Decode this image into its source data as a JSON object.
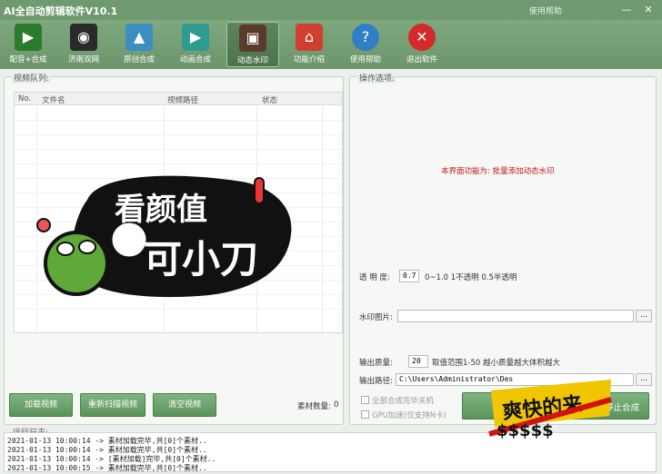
{
  "window": {
    "title": "AI全自动剪辑软件V10.1",
    "help_link": "使用帮助",
    "min_glyph": "—",
    "close_glyph": "✕"
  },
  "toolbar": {
    "items": [
      {
        "label": "配音+合成",
        "icon": "clapperboard-icon",
        "color": "#2c7a2c"
      },
      {
        "label": "济南双网",
        "icon": "film-reel-icon",
        "color": "#2a2a2a"
      },
      {
        "label": "原创合成",
        "icon": "image-icon",
        "color": "#3a8fc0"
      },
      {
        "label": "动画合成",
        "icon": "film-strip-icon",
        "color": "#2f9a8f"
      },
      {
        "label": "动态水印",
        "icon": "picture-frame-icon",
        "color": "#5a3a2a"
      },
      {
        "label": "功能介绍",
        "icon": "home-icon",
        "color": "#d04030"
      },
      {
        "label": "使用帮助",
        "icon": "help-icon",
        "color": "#2f7fc8"
      },
      {
        "label": "退出软件",
        "icon": "exit-icon",
        "color": "#d42a2a"
      }
    ]
  },
  "video_queue": {
    "title": "视频队列:",
    "columns": [
      "No.",
      "文件名",
      "视频路径",
      "状态"
    ],
    "buttons": {
      "load": "加载视频",
      "rescan": "重新扫描视频",
      "clear": "清空视频"
    },
    "count_label": "素材数量:",
    "count_value": "0"
  },
  "options": {
    "title": "操作选项:",
    "description": "本界面功能为: 批量添加动态水印",
    "opacity_label": "透 明 度:",
    "opacity_value": "0.7",
    "opacity_hint": "0~1.0 1不透明 0.5半透明",
    "watermark_label": "水印图片:",
    "watermark_value": "",
    "browse_label": "...",
    "quality_label": "输出质量:",
    "quality_value": "20",
    "quality_hint": "取值范围1-50 越小质量越大体积越大",
    "output_label": "输出路径:",
    "output_value": "C:\\Users\\Administrator\\Des",
    "merge_shutdown": "全部合成完毕关机",
    "gpu_accel": "GPU加速(仅支持N卡)",
    "stop_button": "停止合成"
  },
  "log": {
    "title": "运行日志:",
    "lines": [
      "2021-01-13 10:00:14 -> 素材加载完毕,共[0]个素材..",
      "2021-01-13 10:00:14 -> 素材加载完毕,共[0]个素材..",
      "2021-01-13 10:00:14 -> [素材加载]完毕,共[0]个素材..",
      "2021-01-13 10:00:15 -> 素材加载完毕,共[0]个素材.."
    ]
  },
  "sticker": {
    "line1": "看颜值",
    "line2": "可小刀"
  },
  "badge": {
    "text": "爽快的来",
    "glyphs": "$$$$$"
  }
}
